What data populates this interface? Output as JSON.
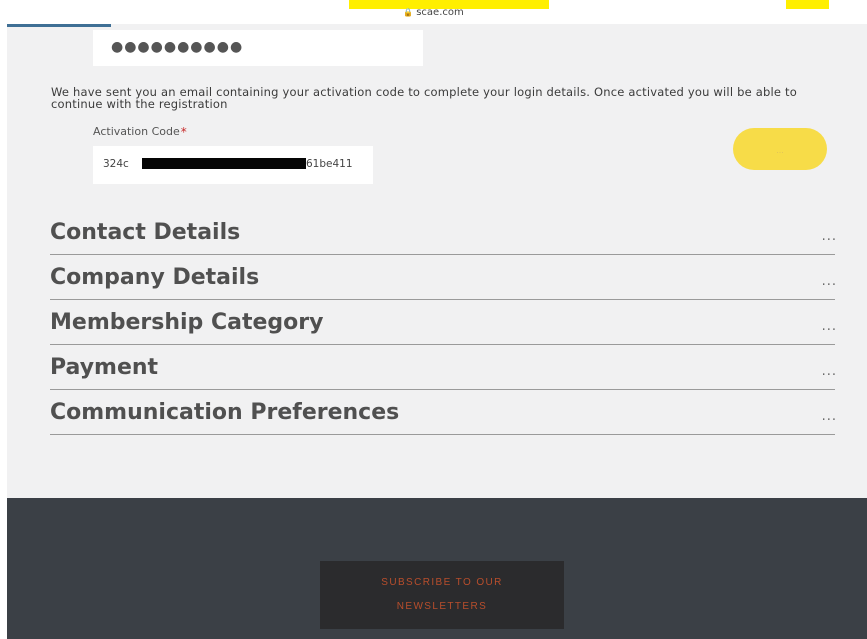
{
  "browser": {
    "url": "scae.com"
  },
  "login": {
    "password_masked": "●●●●●●●●●●",
    "message": "We have sent you an email containing your activation code to complete your login details. Once activated you will be able to continue with the registration",
    "activation_label": "Activation Code",
    "required_marker": "*",
    "activation_value_start": "324c",
    "activation_value_end": "61be411",
    "submit_label": "..."
  },
  "sections": [
    {
      "title": "Contact Details",
      "more": "..."
    },
    {
      "title": "Company Details",
      "more": "..."
    },
    {
      "title": "Membership Category",
      "more": "..."
    },
    {
      "title": "Payment",
      "more": "..."
    },
    {
      "title": "Communication Preferences",
      "more": "..."
    }
  ],
  "footer": {
    "newsletter_line1": "SUBSCRIBE TO OUR",
    "newsletter_line2": "NEWSLETTERS"
  },
  "colors": {
    "accent": "#f7dc48",
    "footer_bg": "#3b4046",
    "newsletter_text": "#b84e2c"
  }
}
